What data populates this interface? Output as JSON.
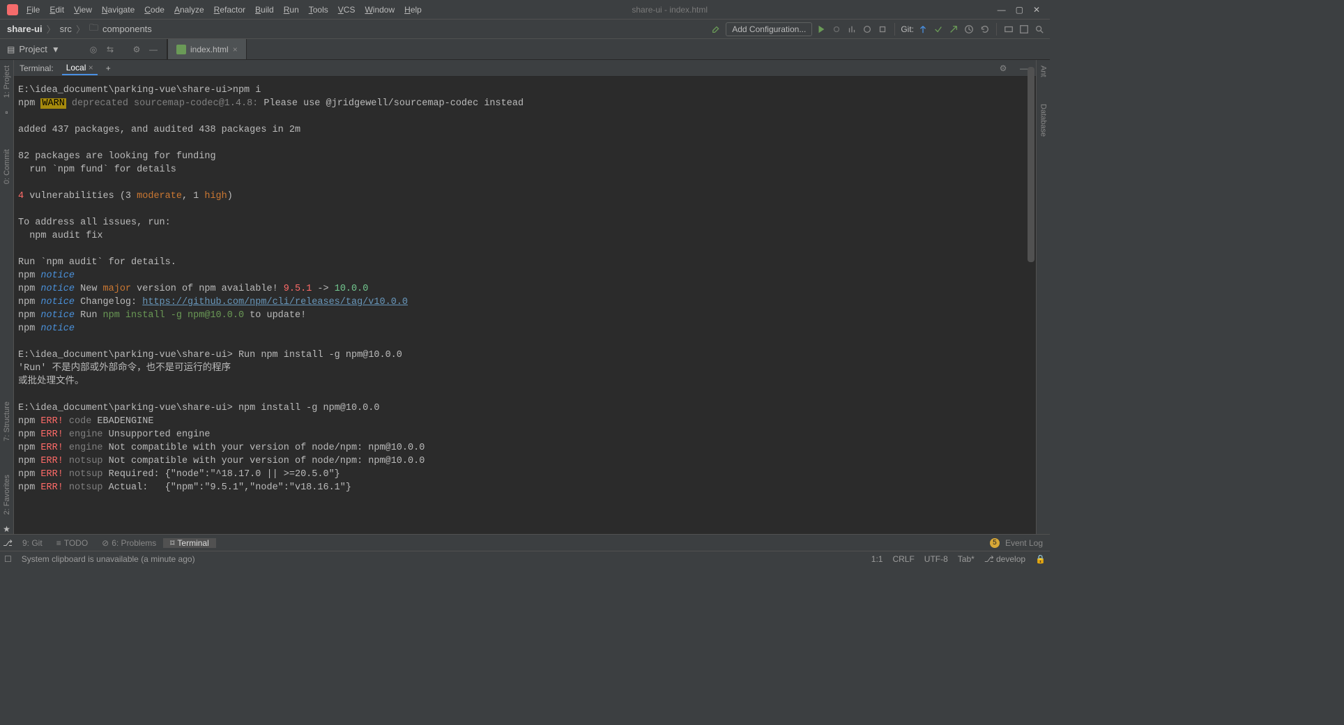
{
  "window": {
    "title": "share-ui - index.html"
  },
  "menu": [
    "File",
    "Edit",
    "View",
    "Navigate",
    "Code",
    "Analyze",
    "Refactor",
    "Build",
    "Run",
    "Tools",
    "VCS",
    "Window",
    "Help"
  ],
  "breadcrumb": {
    "root": "share-ui",
    "p1": "src",
    "p2": "components"
  },
  "toolbar": {
    "combo": "Add Configuration...",
    "git_label": "Git:"
  },
  "project_panel": {
    "label": "Project"
  },
  "editor_tabs": {
    "file": "index.html"
  },
  "left_panels": {
    "project": "1: Project",
    "commit": "0: Commit",
    "structure": "7: Structure",
    "favorites": "2: Favorites"
  },
  "right_panels": {
    "ant": "Ant",
    "database": "Database"
  },
  "terminal": {
    "header": "Terminal:",
    "tab": "Local",
    "plus": "+"
  },
  "bottom": {
    "git": "9: Git",
    "todo": "TODO",
    "problems": "6: Problems",
    "terminal": "Terminal",
    "event_badge": "5",
    "event_log": "Event Log"
  },
  "status": {
    "msg": "System clipboard is unavailable (a minute ago)",
    "pos": "1:1",
    "le": "CRLF",
    "enc": "UTF-8",
    "indent": "Tab*",
    "branch": "develop"
  },
  "lines": [
    {
      "t": "plain",
      "segs": [
        {
          "c": "plain",
          "s": "E:\\idea_document\\parking-vue\\share-ui>npm i"
        }
      ]
    },
    {
      "t": "plain",
      "segs": [
        {
          "c": "plain",
          "s": "npm "
        },
        {
          "c": "warn",
          "s": "WARN"
        },
        {
          "c": "plain",
          "s": " "
        },
        {
          "c": "dep",
          "s": "deprecated"
        },
        {
          "c": "plain",
          "s": " "
        },
        {
          "c": "mod",
          "s": "sourcemap-codec@1.4.8:"
        },
        {
          "c": "plain",
          "s": " Please use @jridgewell/sourcemap-codec instead"
        }
      ]
    },
    {
      "t": "blank",
      "segs": []
    },
    {
      "t": "plain",
      "segs": [
        {
          "c": "plain",
          "s": "added 437 packages, and audited 438 packages in 2m"
        }
      ]
    },
    {
      "t": "blank",
      "segs": []
    },
    {
      "t": "plain",
      "segs": [
        {
          "c": "plain",
          "s": "82 packages are looking for funding"
        }
      ]
    },
    {
      "t": "plain",
      "segs": [
        {
          "c": "plain",
          "s": "  run `npm fund` for details"
        }
      ]
    },
    {
      "t": "blank",
      "segs": []
    },
    {
      "t": "plain",
      "segs": [
        {
          "c": "num-red",
          "s": "4"
        },
        {
          "c": "plain",
          "s": " vulnerabilities (3 "
        },
        {
          "c": "ky",
          "s": "moderate"
        },
        {
          "c": "plain",
          "s": ", 1 "
        },
        {
          "c": "ky",
          "s": "high"
        },
        {
          "c": "plain",
          "s": ")"
        }
      ]
    },
    {
      "t": "blank",
      "segs": []
    },
    {
      "t": "plain",
      "segs": [
        {
          "c": "plain",
          "s": "To address all issues, run:"
        }
      ]
    },
    {
      "t": "plain",
      "segs": [
        {
          "c": "plain",
          "s": "  npm audit fix"
        }
      ]
    },
    {
      "t": "blank",
      "segs": []
    },
    {
      "t": "plain",
      "segs": [
        {
          "c": "plain",
          "s": "Run `npm audit` for details."
        }
      ]
    },
    {
      "t": "plain",
      "segs": [
        {
          "c": "plain",
          "s": "npm "
        },
        {
          "c": "notice",
          "s": "notice"
        }
      ]
    },
    {
      "t": "plain",
      "segs": [
        {
          "c": "plain",
          "s": "npm "
        },
        {
          "c": "notice",
          "s": "notice"
        },
        {
          "c": "plain",
          "s": " New "
        },
        {
          "c": "keyword",
          "s": "major"
        },
        {
          "c": "plain",
          "s": " version of npm available! "
        },
        {
          "c": "num-red",
          "s": "9.5.1"
        },
        {
          "c": "plain",
          "s": " -> "
        },
        {
          "c": "num-teal",
          "s": "10.0.0"
        }
      ]
    },
    {
      "t": "plain",
      "segs": [
        {
          "c": "plain",
          "s": "npm "
        },
        {
          "c": "notice",
          "s": "notice"
        },
        {
          "c": "plain",
          "s": " Changelog: "
        },
        {
          "c": "link",
          "s": "https://github.com/npm/cli/releases/tag/v10.0.0"
        }
      ]
    },
    {
      "t": "plain",
      "segs": [
        {
          "c": "plain",
          "s": "npm "
        },
        {
          "c": "notice",
          "s": "notice"
        },
        {
          "c": "plain",
          "s": " Run "
        },
        {
          "c": "cmd",
          "s": "npm install -g npm@10.0.0"
        },
        {
          "c": "plain",
          "s": " to update!"
        }
      ]
    },
    {
      "t": "plain",
      "segs": [
        {
          "c": "plain",
          "s": "npm "
        },
        {
          "c": "notice",
          "s": "notice"
        }
      ]
    },
    {
      "t": "blank",
      "segs": []
    },
    {
      "t": "plain",
      "segs": [
        {
          "c": "plain",
          "s": "E:\\idea_document\\parking-vue\\share-ui> Run npm install -g npm@10.0.0"
        }
      ]
    },
    {
      "t": "plain",
      "segs": [
        {
          "c": "plain",
          "s": "'Run' 不是内部或外部命令，也不是可运行的程序"
        }
      ]
    },
    {
      "t": "plain",
      "segs": [
        {
          "c": "plain",
          "s": "或批处理文件。"
        }
      ]
    },
    {
      "t": "blank",
      "segs": []
    },
    {
      "t": "plain",
      "segs": [
        {
          "c": "plain",
          "s": "E:\\idea_document\\parking-vue\\share-ui> npm install -g npm@10.0.0"
        }
      ]
    },
    {
      "t": "plain",
      "segs": [
        {
          "c": "plain",
          "s": "npm "
        },
        {
          "c": "err",
          "s": "ERR!"
        },
        {
          "c": "plain",
          "s": " "
        },
        {
          "c": "dep",
          "s": "code"
        },
        {
          "c": "plain",
          "s": " EBADENGINE"
        }
      ]
    },
    {
      "t": "plain",
      "segs": [
        {
          "c": "plain",
          "s": "npm "
        },
        {
          "c": "err",
          "s": "ERR!"
        },
        {
          "c": "plain",
          "s": " "
        },
        {
          "c": "dep",
          "s": "engine"
        },
        {
          "c": "plain",
          "s": " Unsupported engine"
        }
      ]
    },
    {
      "t": "plain",
      "segs": [
        {
          "c": "plain",
          "s": "npm "
        },
        {
          "c": "err",
          "s": "ERR!"
        },
        {
          "c": "plain",
          "s": " "
        },
        {
          "c": "dep",
          "s": "engine"
        },
        {
          "c": "plain",
          "s": " Not compatible with your version of node/npm: npm@10.0.0"
        }
      ]
    },
    {
      "t": "plain",
      "segs": [
        {
          "c": "plain",
          "s": "npm "
        },
        {
          "c": "err",
          "s": "ERR!"
        },
        {
          "c": "plain",
          "s": " "
        },
        {
          "c": "dep",
          "s": "notsup"
        },
        {
          "c": "plain",
          "s": " Not compatible with your version of node/npm: npm@10.0.0"
        }
      ]
    },
    {
      "t": "plain",
      "segs": [
        {
          "c": "plain",
          "s": "npm "
        },
        {
          "c": "err",
          "s": "ERR!"
        },
        {
          "c": "plain",
          "s": " "
        },
        {
          "c": "dep",
          "s": "notsup"
        },
        {
          "c": "plain",
          "s": " Required: {\"node\":\"^18.17.0 || >=20.5.0\"}"
        }
      ]
    },
    {
      "t": "plain",
      "segs": [
        {
          "c": "plain",
          "s": "npm "
        },
        {
          "c": "err",
          "s": "ERR!"
        },
        {
          "c": "plain",
          "s": " "
        },
        {
          "c": "dep",
          "s": "notsup"
        },
        {
          "c": "plain",
          "s": " Actual:   {\"npm\":\"9.5.1\",\"node\":\"v18.16.1\"}"
        }
      ]
    }
  ]
}
